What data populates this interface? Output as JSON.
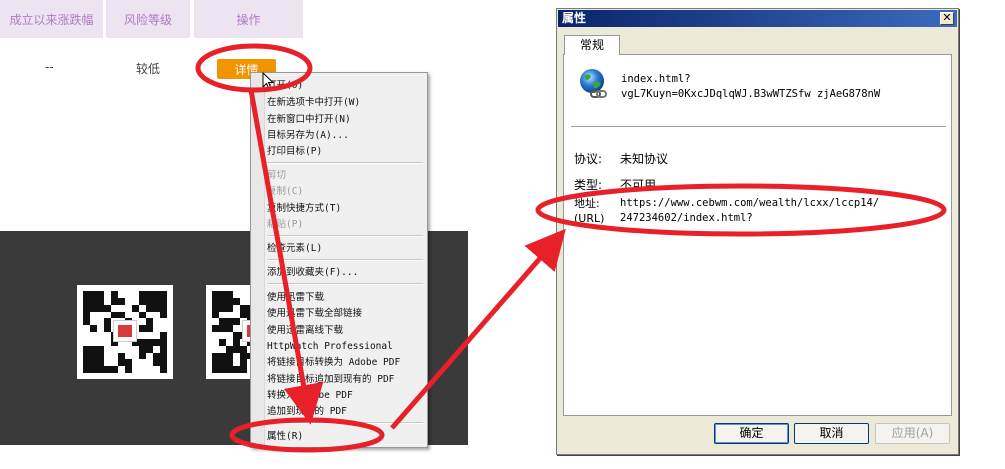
{
  "table": {
    "headers": [
      "成立以来涨跌幅",
      "风险等级",
      "操作"
    ],
    "row": {
      "change": "--",
      "risk": "较低",
      "action": "详情"
    }
  },
  "context_menu": {
    "items": [
      {
        "label": "打开(O)",
        "disabled": false
      },
      {
        "label": "在新选项卡中打开(W)",
        "disabled": false
      },
      {
        "label": "在新窗口中打开(N)",
        "disabled": false
      },
      {
        "label": "目标另存为(A)...",
        "disabled": false
      },
      {
        "label": "打印目标(P)",
        "disabled": false
      },
      {
        "label": "剪切",
        "disabled": true
      },
      {
        "label": "复制(C)",
        "disabled": true
      },
      {
        "label": "复制快捷方式(T)",
        "disabled": false
      },
      {
        "label": "粘贴(P)",
        "disabled": true
      },
      {
        "label": "检查元素(L)",
        "disabled": false
      },
      {
        "label": "添加到收藏夹(F)...",
        "disabled": false
      },
      {
        "label": "使用迅雷下载",
        "disabled": false
      },
      {
        "label": "使用迅雷下载全部链接",
        "disabled": false
      },
      {
        "label": "使用迅雷离线下载",
        "disabled": false
      },
      {
        "label": "HttpWatch Professional",
        "disabled": false
      },
      {
        "label": "将链接目标转换为 Adobe PDF",
        "disabled": false
      },
      {
        "label": "将链接目标追加到现有的 PDF",
        "disabled": false
      },
      {
        "label": "转换为 Adobe PDF",
        "disabled": false
      },
      {
        "label": "追加到现有的 PDF",
        "disabled": false
      },
      {
        "label": "属性(R)",
        "disabled": false
      }
    ]
  },
  "dialog": {
    "title": "属性",
    "close_glyph": "✕",
    "tab": "常规",
    "file_name_line1": "index.html?",
    "file_name_line2": "vgL7Kuyn=0KxcJDqlqWJ.B3wWTZSfw zjAeG878nW",
    "protocol_label": "协议:",
    "protocol_value": "未知协议",
    "type_label": "类型:",
    "type_value": "不可用",
    "address_label_line1": "地址:",
    "address_label_line2": "(URL)",
    "address_value_line1": "https://www.cebwm.com/wealth/lcxx/lccp14/",
    "address_value_line2": "247234602/index.html?",
    "buttons": {
      "ok": "确定",
      "cancel": "取消",
      "apply": "应用(A)"
    }
  },
  "colors": {
    "header_bg": "#ede4f1",
    "header_text": "#b07ac6",
    "detail_button": "#f29300",
    "footer_dark": "#3a3a3a",
    "annotation_red": "#e8202a",
    "dialog_title": "#0a246a"
  },
  "icons": [
    "cursor-arrow-icon",
    "globe-link-icon",
    "close-icon",
    "qr-code-icon"
  ]
}
